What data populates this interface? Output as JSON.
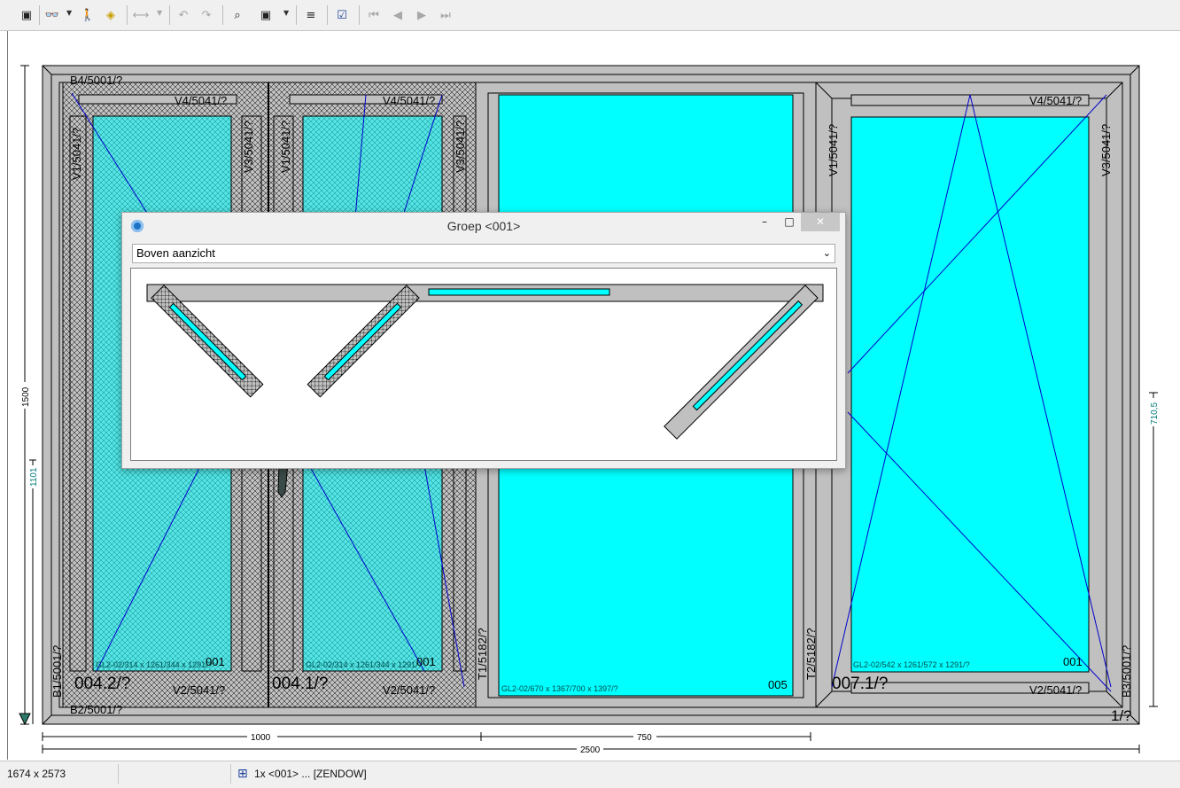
{
  "toolbar": {
    "items": [
      {
        "name": "app-logo-icon",
        "glyph": "▣"
      },
      {
        "name": "glasses-icon",
        "glyph": "👓"
      },
      {
        "name": "person-icon",
        "glyph": "🚶"
      },
      {
        "name": "layers-icon",
        "glyph": "◈"
      },
      {
        "name": "dimension-icon",
        "glyph": "⟷"
      },
      {
        "name": "undo-icon",
        "glyph": "↶"
      },
      {
        "name": "redo-icon",
        "glyph": "↷"
      },
      {
        "name": "zoom-select-icon",
        "glyph": "⌕"
      },
      {
        "name": "frame-select-icon",
        "glyph": "▣"
      },
      {
        "name": "align-left-icon",
        "glyph": "≡"
      },
      {
        "name": "checklist-flash-icon",
        "glyph": "☑"
      },
      {
        "name": "first-icon",
        "glyph": "⏮"
      },
      {
        "name": "previous-icon",
        "glyph": "◀"
      },
      {
        "name": "next-icon",
        "glyph": "▶"
      },
      {
        "name": "last-icon",
        "glyph": "⏭"
      }
    ]
  },
  "drawing": {
    "labels": {
      "b4": "B4/5001/?",
      "b2": "B2/5001/?",
      "b1": "B1/5001/?",
      "b3": "B3/5001/?",
      "v4_a": "V4/5041/?",
      "v4_b": "V4/5041/?",
      "v4_c": "V4/5041/?",
      "v2_a": "V2/5041/?",
      "v2_b": "V2/5041/?",
      "v2_c": "V2/5041/?",
      "v1_a": "V1/5041/?",
      "v3_a": "V3/5041/?",
      "v1_b": "V1/5041/?",
      "v3_b": "V3/5041/?",
      "v1_c": "V1/5041/?",
      "v3_c": "V3/5041/?",
      "t1": "T1/5182/?",
      "t2": "T2/5182/?",
      "sash_a": "004.2/?",
      "sash_b": "004.1/?",
      "sash_c": "007.1/?",
      "glass_a": "GL2-02/314 x 1261/344 x 1291/?",
      "glass_b": "GL2-02/314 x 1261/344 x 1291/?",
      "glass_c": "GL2-02/670 x 1367/700 x 1397/?",
      "glass_d": "GL2-02/542 x 1261/572 x 1291/?",
      "num_a": "001",
      "num_b": "001",
      "num_c": "005",
      "num_d": "001",
      "frame_id": "1/?"
    },
    "dimensions": {
      "height_total": "1500",
      "height_handle": "1101",
      "height_right": "710,5",
      "width_left": "1000",
      "width_mid": "750",
      "width_total": "2500"
    },
    "colors": {
      "glass": "#00ffff",
      "profile": "#c0c0c0",
      "outline": "#000000",
      "opening_lines": "#0000cc",
      "dim_text": "#007b7b"
    }
  },
  "dialog": {
    "title": "Groep <001>",
    "minimize": "–",
    "maximize": "□",
    "close": "✕",
    "view_select": {
      "selected": "Boven aanzicht"
    }
  },
  "status": {
    "size": "1674 x 2573",
    "group": "1x <001> ... [ZENDOW]"
  }
}
